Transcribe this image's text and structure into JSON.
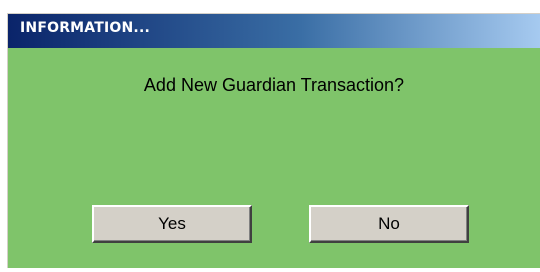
{
  "dialog": {
    "title": "INFORMATION...",
    "message": "Add New Guardian Transaction?",
    "buttons": {
      "yes_label": "Yes",
      "no_label": "No"
    }
  },
  "colors": {
    "body_background": "#7fc46a",
    "titlebar_start": "#0a246a",
    "titlebar_end": "#a6caf0",
    "button_face": "#d4d0c8"
  }
}
